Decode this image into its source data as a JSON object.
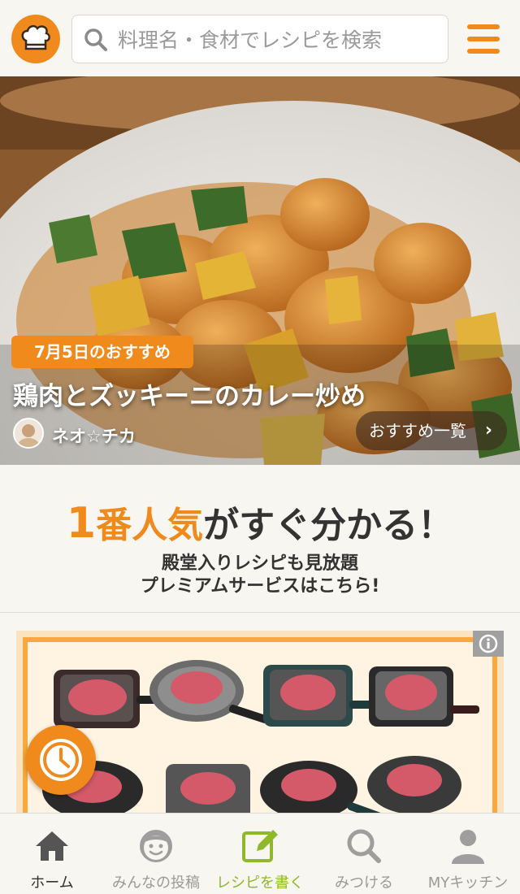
{
  "header": {
    "logo_icon": "chef-hat-icon",
    "search_placeholder": "料理名・食材でレシピを検索",
    "menu_icon": "hamburger-menu-icon",
    "accent_color": "#f08a1c"
  },
  "hero": {
    "badge": "7月5日のおすすめ",
    "recipe_title": "鶏肉とズッキーニのカレー炒め",
    "author_name": "ネオ☆チカ",
    "more_label": "おすすめ一覧"
  },
  "promo": {
    "headline_num": "1",
    "headline_highlight": "番人気",
    "headline_rest": "がすぐ分かる！",
    "sub_line1": "殿堂入りレシピも見放題",
    "sub_line2": "プレミアムサービスはこちら!"
  },
  "ad": {
    "info_icon": "info-icon"
  },
  "floating": {
    "icon": "clock-icon"
  },
  "nav": {
    "items": [
      {
        "label": "ホーム",
        "icon": "home-icon"
      },
      {
        "label": "みんなの投稿",
        "icon": "smiley-face-icon"
      },
      {
        "label": "レシピを書く",
        "icon": "edit-icon"
      },
      {
        "label": "みつける",
        "icon": "search-icon"
      },
      {
        "label": "MYキッチン",
        "icon": "user-icon"
      }
    ]
  }
}
